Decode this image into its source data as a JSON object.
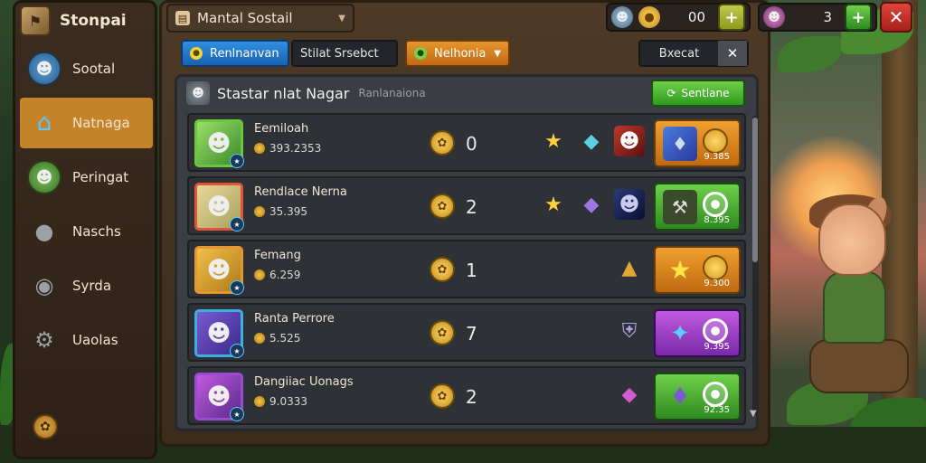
{
  "sidebar": {
    "title": "Stonpai",
    "items": [
      {
        "label": "Sootal",
        "icon": "character-avatar-icon",
        "active": false
      },
      {
        "label": "Natnaga",
        "icon": "house-icon",
        "active": true
      },
      {
        "label": "Peringat",
        "icon": "character-avatar-icon",
        "active": false
      },
      {
        "label": "Naschs",
        "icon": "mask-icon",
        "active": false
      },
      {
        "label": "Syrda",
        "icon": "globe-icon",
        "active": false
      },
      {
        "label": "Uaolas",
        "icon": "gear-icon",
        "active": false
      }
    ],
    "bottom_icon": "paw-coin-icon"
  },
  "header": {
    "title": "Mantal Sostail",
    "resource1": {
      "value": "00",
      "icon": "gold-coin-icon"
    },
    "resource2": {
      "value": "3",
      "icon": "character-avatar-icon"
    }
  },
  "filters": {
    "tab1": "Renlnanvan",
    "tab2": "Stilat Srsebct",
    "tab3": "Nelhonia",
    "select": "Bxecat"
  },
  "panel": {
    "title": "Stastar nlat Nagar",
    "subtitle": "Ranlanaiona",
    "add_button": "Sentlane"
  },
  "rows": [
    {
      "name": "Eemiloah",
      "coins": "393.2353",
      "level": "0",
      "color": "#6ac83a",
      "action_color": "orange",
      "amount": "9.385",
      "action_kind": "coin"
    },
    {
      "name": "Rendlace Nerna",
      "coins": "35.395",
      "level": "2",
      "color": "#e0553a",
      "action_color": "green",
      "amount": "8.395",
      "action_kind": "circle"
    },
    {
      "name": "Femang",
      "coins": "6.259",
      "level": "1",
      "color": "#e6962e",
      "action_color": "orange",
      "amount": "9.300",
      "action_kind": "coin"
    },
    {
      "name": "Ranta Perrore",
      "coins": "5.525",
      "level": "7",
      "color": "#3ab0e0",
      "action_color": "purple",
      "amount": "9.395",
      "action_kind": "circle"
    },
    {
      "name": "Dangiiac Uonags",
      "coins": "9.0333",
      "level": "2",
      "color": "#9a4ad0",
      "action_color": "green",
      "amount": "92.35",
      "action_kind": "circle"
    }
  ]
}
